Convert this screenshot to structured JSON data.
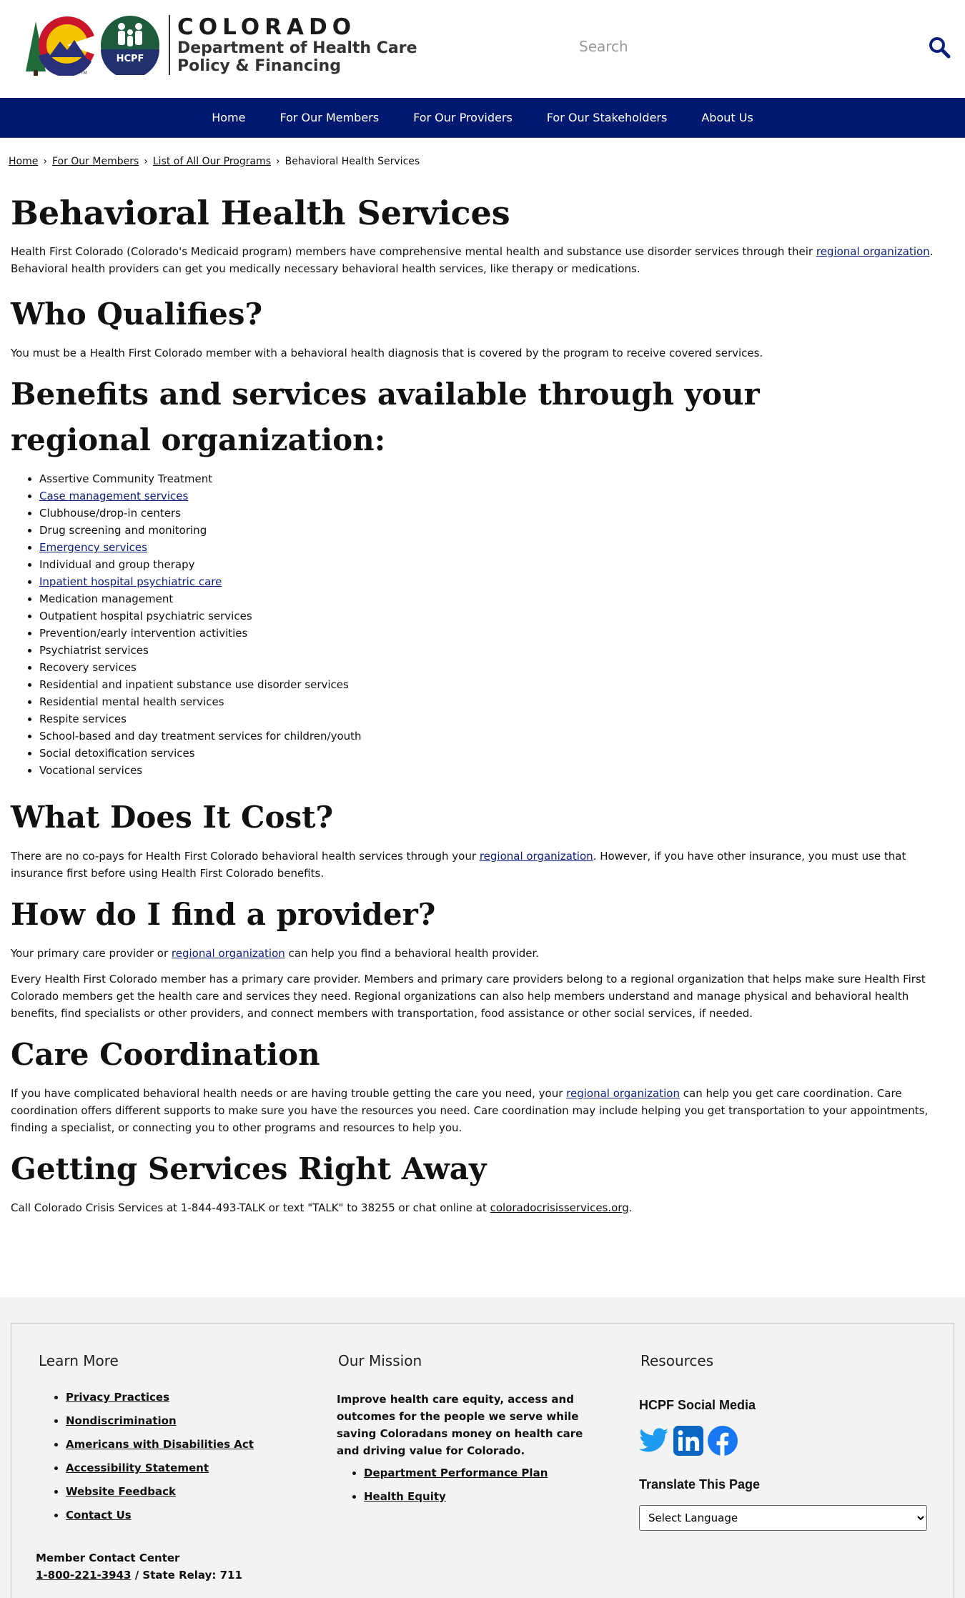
{
  "header": {
    "logo_title": "COLORADO",
    "logo_sub_line1": "Department of Health Care",
    "logo_sub_line2": "Policy & Financing",
    "hcpf_badge": "HCPF",
    "search_placeholder": "Search"
  },
  "nav": {
    "items": [
      "Home",
      "For Our Members",
      "For Our Providers",
      "For Our Stakeholders",
      "About Us"
    ]
  },
  "breadcrumb": {
    "items": [
      "Home",
      "For Our Members",
      "List of All Our Programs"
    ],
    "current": "Behavioral Health Services",
    "separator": "›"
  },
  "page": {
    "title": "Behavioral Health Services",
    "intro_before": "Health First Colorado (Colorado's Medicaid program) members have comprehensive mental health and substance use disorder services through their ",
    "intro_link": "regional organization",
    "intro_after": ". Behavioral health providers can get you medically necessary behavioral health services, like therapy or medications.",
    "qualifies_heading": "Who Qualifies?",
    "qualifies_text": "You must be a Health First Colorado member with a behavioral health diagnosis that is covered by the program to receive covered services.",
    "benefits_heading": "Benefits and services available through your regional organization:",
    "benefits": [
      {
        "text": "Assertive Community Treatment",
        "link": false
      },
      {
        "text": "Case management services",
        "link": true
      },
      {
        "text": "Clubhouse/drop-in centers",
        "link": false
      },
      {
        "text": "Drug screening and monitoring",
        "link": false
      },
      {
        "text": "Emergency services",
        "link": true
      },
      {
        "text": "Individual and group therapy",
        "link": false
      },
      {
        "text": "Inpatient hospital psychiatric care",
        "link": true
      },
      {
        "text": "Medication management",
        "link": false
      },
      {
        "text": "Outpatient hospital psychiatric services",
        "link": false
      },
      {
        "text": "Prevention/early intervention activities",
        "link": false
      },
      {
        "text": "Psychiatrist services",
        "link": false
      },
      {
        "text": "Recovery services",
        "link": false
      },
      {
        "text": "Residential and inpatient substance use disorder services",
        "link": false
      },
      {
        "text": "Residential mental health services",
        "link": false
      },
      {
        "text": "Respite services",
        "link": false
      },
      {
        "text": "School-based and day treatment services for children/youth",
        "link": false
      },
      {
        "text": "Social detoxification services",
        "link": false
      },
      {
        "text": "Vocational services",
        "link": false
      }
    ],
    "cost_heading": "What Does It Cost?",
    "cost_before": "There are no co-pays for Health First Colorado behavioral health services through your ",
    "cost_link": "regional organization",
    "cost_after": ". However, if you have other insurance, you must use that insurance first before using Health First Colorado benefits.",
    "provider_heading": "How do I find a provider?",
    "provider_before": "Your primary care provider or ",
    "provider_link": "regional organization",
    "provider_after": " can help you find a behavioral health provider.",
    "provider_text2": "Every Health First Colorado member has a primary care provider. Members and primary care providers belong to a regional organization that helps make sure Health First Colorado members get the health care and services they need. Regional organizations can also help members understand and manage physical and behavioral health benefits, find specialists or other providers, and connect members with transportation, food assistance or other social services, if needed.",
    "care_heading": "Care Coordination",
    "care_before": "If you have complicated behavioral health needs or are having trouble getting the care you need, your ",
    "care_link": "regional organization",
    "care_after": " can help you get care coordination. Care coordination offers different supports to make sure you have the resources you need. Care coordination may include helping you get transportation to your appointments, finding a specialist, or connecting you to other programs and resources to help you.",
    "away_heading": "Getting Services Right Away",
    "away_before": "Call Colorado Crisis Services at 1-844-493-TALK or text \"TALK\" to 38255 or chat online at ",
    "away_link": "coloradocrisisservices.org",
    "away_after": "."
  },
  "footer": {
    "learn_more": {
      "heading": "Learn More",
      "links": [
        "Privacy Practices",
        "Nondiscrimination",
        "Americans with Disabilities Act",
        "Accessibility Statement",
        "Website Feedback",
        "Contact Us"
      ]
    },
    "contact": {
      "label": "Member Contact Center",
      "phone": "1-800-221-3943",
      "relay": " / State Relay: 711"
    },
    "mission": {
      "heading": "Our Mission",
      "text": "Improve health care equity, access and outcomes for the people we serve while saving Coloradans money on health care and driving value for Colorado.",
      "links": [
        "Department Performance Plan",
        "Health Equity"
      ]
    },
    "resources": {
      "heading": "Resources",
      "social_heading": "HCPF Social Media",
      "social_icons": [
        "twitter-icon",
        "linkedin-icon",
        "facebook-icon"
      ],
      "translate_heading": "Translate This Page",
      "select_value": "Select Language"
    }
  },
  "colors": {
    "nav_bg": "#001970",
    "link": "#0b1f7a",
    "footer_bg": "#f3f3f3",
    "twitter": "#1d9bf0",
    "linkedin": "#0a66c2",
    "facebook": "#1877f2"
  }
}
